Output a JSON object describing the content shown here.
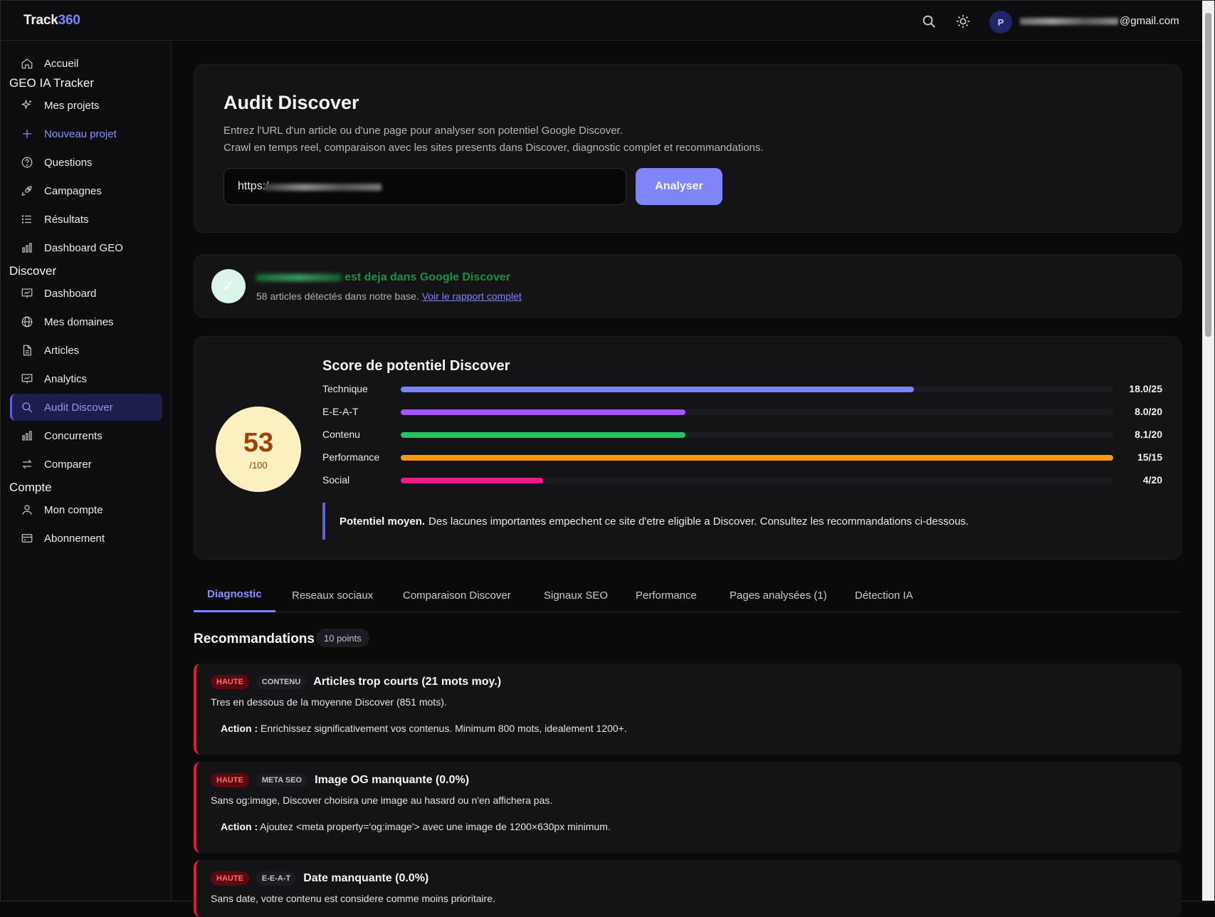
{
  "header": {
    "brand_prefix": "Track",
    "brand_suffix": "360",
    "search_icon": "search-icon",
    "theme_icon": "sun-icon",
    "avatar_initial": "P",
    "email_suffix": "@gmail.com"
  },
  "sidebar": {
    "home": "Accueil",
    "section_geo": "GEO IA Tracker",
    "geo_items": [
      "Mes projets",
      "Nouveau projet",
      "Questions",
      "Campagnes",
      "Résultats",
      "Dashboard GEO"
    ],
    "section_discover": "Discover",
    "discover_items": [
      "Dashboard",
      "Mes domaines",
      "Articles",
      "Analytics",
      "Audit Discover",
      "Concurrents",
      "Comparer"
    ],
    "section_account": "Compte",
    "account_items": [
      "Mon compte",
      "Abonnement"
    ]
  },
  "audit": {
    "title": "Audit Discover",
    "subtitle_1": "Entrez l'URL d'un article ou d'une page pour analyser son potentiel Google Discover.",
    "subtitle_2": "Crawl en temps reel, comparaison avec les sites presents dans Discover, diagnostic complet et recommandations.",
    "url_value": "https:/",
    "button_label": "Analyser"
  },
  "discover_status": {
    "title": "est deja dans Google Discover",
    "description": "58 articles détectés dans notre base.",
    "link_label": "Voir le rapport complet",
    "status_color": "#1e8f45"
  },
  "score": {
    "value": "53",
    "max": "/100",
    "title": "Score de potentiel Discover",
    "bars": [
      {
        "label": "Technique",
        "value_text": "18.0/25",
        "fraction": 0.72,
        "color": "#7c83f7"
      },
      {
        "label": "E-E-A-T",
        "value_text": "8.0/20",
        "fraction": 0.4,
        "color": "#a855f7"
      },
      {
        "label": "Contenu",
        "value_text": "8.1/20",
        "fraction": 0.4,
        "color": "#22c55e"
      },
      {
        "label": "Performance",
        "value_text": "15/15",
        "fraction": 1.0,
        "color": "#fb9a0e"
      },
      {
        "label": "Social",
        "value_text": "4/20",
        "fraction": 0.2,
        "color": "#ec1c8c"
      }
    ],
    "verdict_strong": "Potentiel moyen.",
    "verdict_text": "Des lacunes importantes empechent ce site d'etre eligible a Discover. Consultez les recommandations ci-dessous."
  },
  "tabs": [
    "Diagnostic",
    "Reseaux sociaux",
    "Comparaison Discover",
    "Signaux SEO",
    "Performance",
    "Pages analysées (1)",
    "Détection IA"
  ],
  "recommendations": {
    "title": "Recommandations",
    "count_label": "10 points",
    "action_label": "Action :",
    "items": [
      {
        "priority": "HAUTE",
        "category": "CONTENU",
        "title": "Articles trop courts (21 mots moy.)",
        "description": "Tres en dessous de la moyenne Discover (851 mots).",
        "action": "Enrichissez significativement vos contenus. Minimum 800 mots, idealement 1200+."
      },
      {
        "priority": "HAUTE",
        "category": "META SEO",
        "title": "Image OG manquante (0.0%)",
        "description": "Sans og:image, Discover choisira une image au hasard ou n'en affichera pas.",
        "action": "Ajoutez <meta property='og:image'> avec une image de 1200×630px minimum."
      },
      {
        "priority": "HAUTE",
        "category": "E-E-A-T",
        "title": "Date manquante (0.0%)",
        "description": "Sans date, votre contenu est considere comme moins prioritaire.",
        "action": ""
      }
    ]
  }
}
